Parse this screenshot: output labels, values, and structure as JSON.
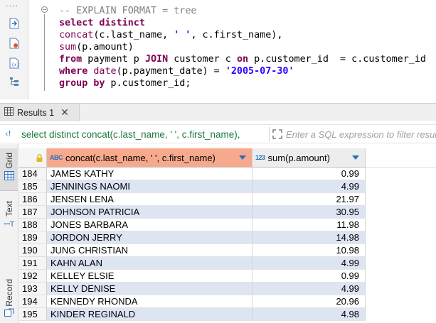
{
  "editor": {
    "gutter_dots": "····",
    "lines": [
      [
        {
          "t": "-- EXPLAIN FORMAT = tree",
          "c": "cmt"
        }
      ],
      [
        {
          "t": "select distinct",
          "c": "kw"
        }
      ],
      [
        {
          "t": "concat",
          "c": "fn"
        },
        {
          "t": "(c.last_name, ",
          "c": ""
        },
        {
          "t": "' '",
          "c": "str"
        },
        {
          "t": ", c.first_name),",
          "c": ""
        }
      ],
      [
        {
          "t": "sum",
          "c": "fn"
        },
        {
          "t": "(p.amount)",
          "c": ""
        }
      ],
      [
        {
          "t": "from",
          "c": "kw"
        },
        {
          "t": " payment p ",
          "c": ""
        },
        {
          "t": "JOIN",
          "c": "kw"
        },
        {
          "t": " customer c ",
          "c": ""
        },
        {
          "t": "on",
          "c": "kw"
        },
        {
          "t": " p.customer_id  = c.customer_id",
          "c": ""
        }
      ],
      [
        {
          "t": "where",
          "c": "kw"
        },
        {
          "t": " ",
          "c": ""
        },
        {
          "t": "date",
          "c": "fn"
        },
        {
          "t": "(p.payment_date) = ",
          "c": ""
        },
        {
          "t": "'2005-07-30'",
          "c": "str"
        }
      ],
      [
        {
          "t": "group by",
          "c": "kw"
        },
        {
          "t": " p.customer_id;",
          "c": ""
        }
      ]
    ]
  },
  "results_tab": {
    "label": "Results 1",
    "close": "✕"
  },
  "filter_bar": {
    "query_text": "select distinct concat(c.last_name, ' ', c.first_name),",
    "placeholder": "Enter a SQL expression to filter results (use Ctrl+Space)"
  },
  "side_tabs": {
    "grid": "Grid",
    "text": "Text",
    "record": "Record"
  },
  "grid": {
    "columns": [
      {
        "type_badge": "ABC",
        "label": "concat(c.last_name, ' ', c.first_name)"
      },
      {
        "type_badge": "123",
        "label": "sum(p.amount)"
      }
    ],
    "rows": [
      {
        "num": "184",
        "name": "JAMES KATHY",
        "amount": "0.99"
      },
      {
        "num": "185",
        "name": "JENNINGS NAOMI",
        "amount": "4.99"
      },
      {
        "num": "186",
        "name": "JENSEN LENA",
        "amount": "21.97"
      },
      {
        "num": "187",
        "name": "JOHNSON PATRICIA",
        "amount": "30.95"
      },
      {
        "num": "188",
        "name": "JONES BARBARA",
        "amount": "11.98"
      },
      {
        "num": "189",
        "name": "JORDON JERRY",
        "amount": "14.98"
      },
      {
        "num": "190",
        "name": "JUNG CHRISTIAN",
        "amount": "10.98"
      },
      {
        "num": "191",
        "name": "KAHN ALAN",
        "amount": "4.99"
      },
      {
        "num": "192",
        "name": "KELLEY ELSIE",
        "amount": "0.99"
      },
      {
        "num": "193",
        "name": "KELLY DENISE",
        "amount": "4.99"
      },
      {
        "num": "194",
        "name": "KENNEDY RHONDA",
        "amount": "20.96"
      },
      {
        "num": "195",
        "name": "KINDER REGINALD",
        "amount": "4.98"
      }
    ]
  },
  "colors": {
    "sorted_column_header": "#f6a98c",
    "alt_row": "#dde4f2",
    "keyword": "#7f0055",
    "string_literal": "#2a00ff",
    "filter_query": "#1a7a3a"
  }
}
